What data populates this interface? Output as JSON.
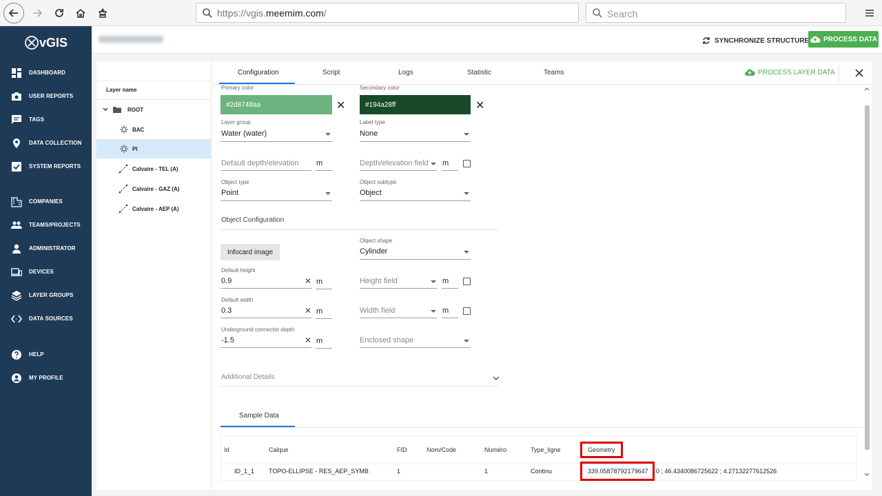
{
  "browser": {
    "url_prefix": "https://vgis.",
    "url_domain": "meemim.com",
    "url_suffix": "/",
    "search_placeholder": "Search"
  },
  "app": {
    "logo_text": "vGIS",
    "sync_label": "SYNCHRONIZE STRUCTURE",
    "process_label": "PROCESS DATA"
  },
  "sidebar": {
    "items": [
      {
        "label": "DASHBOARD",
        "icon": "dashboard-icon"
      },
      {
        "label": "USER REPORTS",
        "icon": "camera-icon"
      },
      {
        "label": "TAGS",
        "icon": "chat-icon"
      },
      {
        "label": "DATA COLLECTION",
        "icon": "pin-icon"
      },
      {
        "label": "SYSTEM REPORTS",
        "icon": "check-icon"
      },
      {
        "label": "COMPANIES",
        "icon": "building-icon"
      },
      {
        "label": "TEAMS/PROJECTS",
        "icon": "people-icon"
      },
      {
        "label": "ADMINISTRATOR",
        "icon": "person-icon"
      },
      {
        "label": "DEVICES",
        "icon": "devices-icon"
      },
      {
        "label": "LAYER GROUPS",
        "icon": "layers-icon"
      },
      {
        "label": "DATA SOURCES",
        "icon": "code-icon"
      },
      {
        "label": "HELP",
        "icon": "help-icon"
      },
      {
        "label": "MY PROFILE",
        "icon": "profile-icon"
      }
    ]
  },
  "tree": {
    "header": "Layer name",
    "root": "ROOT",
    "nodes": [
      "BAC",
      "PI",
      "Calvaire - TEL (A)",
      "Calvaire - GAZ (A)",
      "Calvaire - AEP (A)"
    ],
    "selected": "PI"
  },
  "tabs": [
    "Configuration",
    "Script",
    "Logs",
    "Statistic",
    "Teams"
  ],
  "active_tab": "Configuration",
  "process_layer_label": "PROCESS LAYER DATA",
  "form": {
    "primary_color_label": "Primary color",
    "primary_color": "#2d8748aa",
    "secondary_color_label": "Secondary color",
    "secondary_color": "#194a28ff",
    "layer_group_label": "Layer group",
    "layer_group": "Water (water)",
    "label_type_label": "Label type",
    "label_type": "None",
    "default_depth_placeholder": "Default depth/elevation",
    "depth_field_placeholder": "Depth/elevation field",
    "unit": "m",
    "object_type_label": "Object type",
    "object_type": "Point",
    "object_subtype_label": "Object subtype",
    "object_subtype": "Object",
    "object_config_title": "Object Configuration",
    "infocard_button": "Infocard image",
    "object_shape_label": "Object shape",
    "object_shape": "Cylinder",
    "default_height_label": "Default height",
    "default_height": "0.9",
    "height_field_placeholder": "Height field",
    "default_width_label": "Default width",
    "default_width": "0.3",
    "width_field_placeholder": "Width field",
    "connector_depth_label": "Underground connector depth",
    "connector_depth": "-1.5",
    "enclosed_shape_placeholder": "Enclosed shape",
    "additional_details": "Additional Details"
  },
  "sample": {
    "tab": "Sample Data",
    "columns": [
      "Id",
      "Calque",
      "FID",
      "Nom/Code",
      "Numéro",
      "Type_ligne",
      "Geometry"
    ],
    "row": {
      "id": "ID_1_1",
      "calque": "TOPO-ELLIPSE - RES_AEP_SYMB",
      "fid": "1",
      "nom_code": "",
      "numero": "1",
      "type_ligne": "Continu",
      "geometry_part1": "339.05878792179647",
      "geometry_part2": "0 ; 46.4340086725622 ; 4.27132277612526"
    }
  },
  "colors": {
    "sidebar_bg": "#1e3a57",
    "accent_green": "#4caf50",
    "primary_swatch": "#6db380",
    "secondary_swatch": "#194a28",
    "highlight_red": "#e00000",
    "selected_row": "#d6e9f8"
  }
}
